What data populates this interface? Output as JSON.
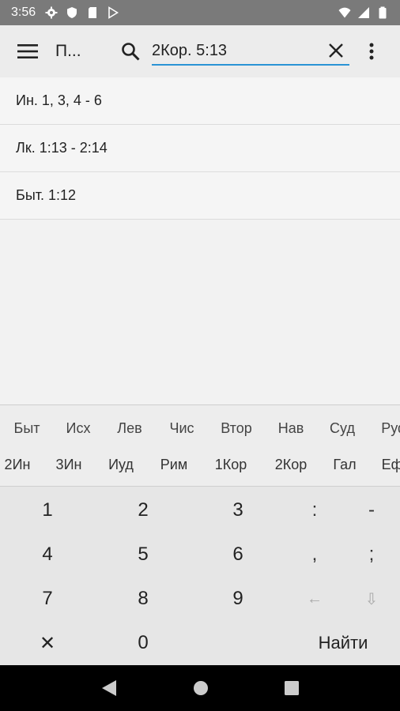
{
  "status_bar": {
    "time": "3:56",
    "left_icons": [
      "gear-icon",
      "shield-icon",
      "sd-card-icon",
      "play-store-icon"
    ],
    "right_icons": [
      "wifi-icon",
      "signal-icon",
      "battery-icon"
    ]
  },
  "app_bar": {
    "title": "П...",
    "search": {
      "value": "2Кор. 5:13",
      "placeholder": ""
    },
    "accent_color": "#2a93d5"
  },
  "results": [
    {
      "label": "Ин. 1, 3, 4 - 6"
    },
    {
      "label": "Лк. 1:13 - 2:14"
    },
    {
      "label": "Быт. 1:12"
    }
  ],
  "books": {
    "row1": [
      "Быт",
      "Исх",
      "Лев",
      "Чис",
      "Втор",
      "Нав",
      "Суд",
      "Руф"
    ],
    "row2": [
      "2Ин",
      "3Ин",
      "Иуд",
      "Рим",
      "1Кор",
      "2Кор",
      "Гал",
      "Еф"
    ]
  },
  "keypad": {
    "k1": "1",
    "k2": "2",
    "k3": "3",
    "colon": ":",
    "dash": "-",
    "k4": "4",
    "k5": "5",
    "k6": "6",
    "comma": ",",
    "semicolon": ";",
    "k7": "7",
    "k8": "8",
    "k9": "9",
    "backspace": "←",
    "down": "⇩",
    "clear": "✕",
    "k0": "0",
    "find": "Найти"
  }
}
